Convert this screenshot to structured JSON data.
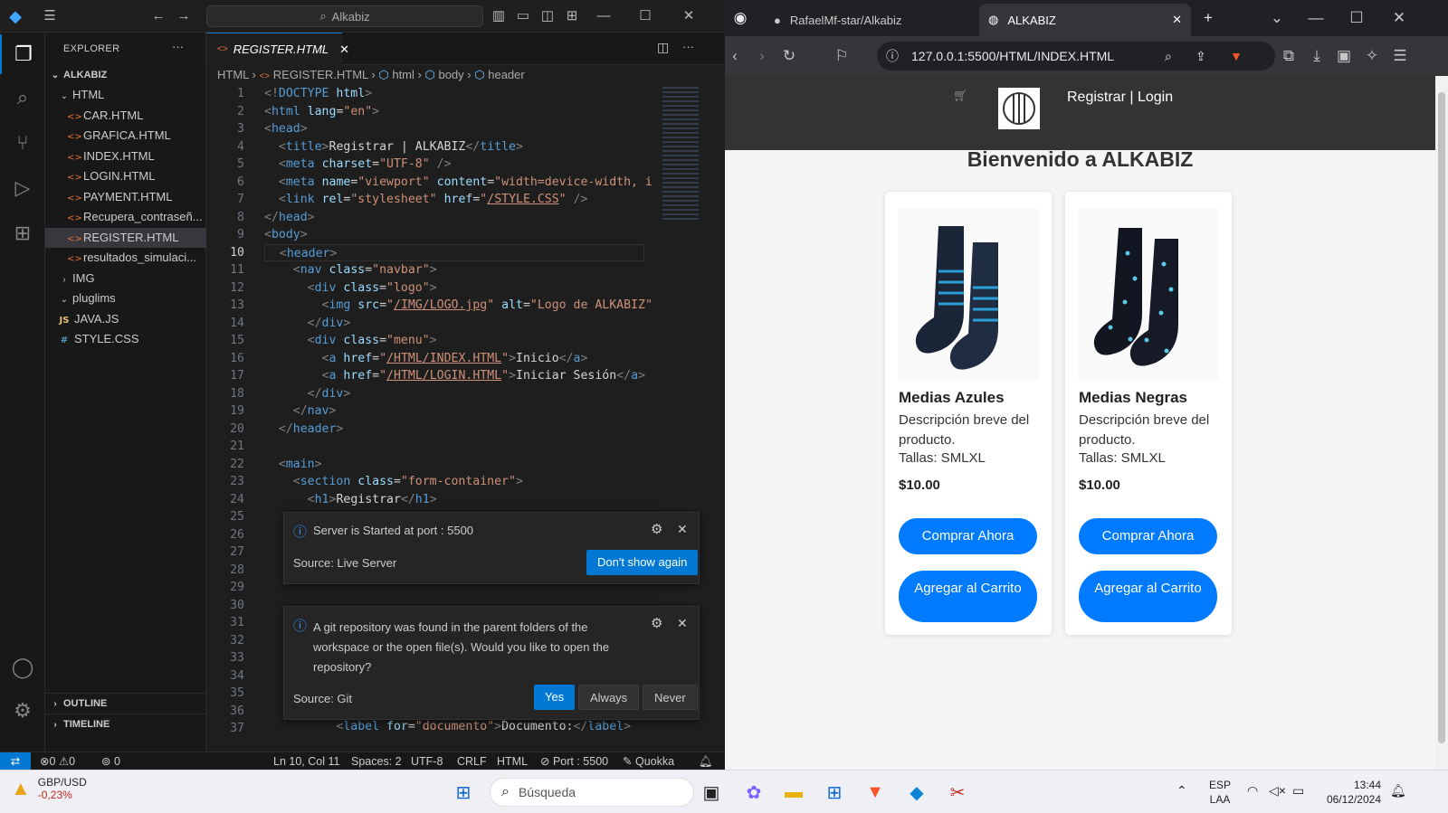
{
  "vscode": {
    "search_text": "Alkabiz",
    "explorer_title": "EXPLORER",
    "root_folder": "ALKABIZ",
    "tree": [
      {
        "label": "HTML",
        "type": "folder-open"
      },
      {
        "label": "CAR.HTML",
        "type": "html"
      },
      {
        "label": "GRAFICA.HTML",
        "type": "html"
      },
      {
        "label": "INDEX.HTML",
        "type": "html"
      },
      {
        "label": "LOGIN.HTML",
        "type": "html"
      },
      {
        "label": "PAYMENT.HTML",
        "type": "html"
      },
      {
        "label": "Recupera_contraseñ...",
        "type": "html"
      },
      {
        "label": "REGISTER.HTML",
        "type": "html",
        "selected": true
      },
      {
        "label": "resultados_simulaci...",
        "type": "html"
      },
      {
        "label": "IMG",
        "type": "folder"
      },
      {
        "label": "pluglims",
        "type": "folder-open"
      },
      {
        "label": "JAVA.JS",
        "type": "js"
      },
      {
        "label": "STYLE.CSS",
        "type": "css"
      }
    ],
    "outline_label": "OUTLINE",
    "timeline_label": "TIMELINE",
    "active_tab": "REGISTER.HTML",
    "breadcrumbs": [
      "HTML",
      "REGISTER.HTML",
      "html",
      "body",
      "header"
    ],
    "line_numbers": [
      "1",
      "2",
      "3",
      "4",
      "5",
      "6",
      "7",
      "8",
      "9",
      "10",
      "11",
      "12",
      "13",
      "14",
      "15",
      "16",
      "17",
      "18",
      "19",
      "20",
      "21",
      "22",
      "23",
      "24",
      "25",
      "26",
      "27",
      "28",
      "29",
      "30",
      "31",
      "32",
      "33",
      "34",
      "35",
      "36",
      "37"
    ],
    "current_line": "10",
    "notifications": [
      {
        "message": "Server is Started at port : 5500",
        "source": "Source: Live Server",
        "buttons": [
          "Don't show again"
        ]
      },
      {
        "message": "A git repository was found in the parent folders of the workspace or the open file(s). Would you like to open the repository?",
        "source": "Source: Git",
        "buttons": [
          "Yes",
          "Always",
          "Never"
        ]
      }
    ],
    "status": {
      "errors": "0",
      "warnings": "0",
      "ports": "0",
      "cursor": "Ln 10, Col 11",
      "spaces": "Spaces: 2",
      "encoding": "UTF-8",
      "eol": "CRLF",
      "language": "HTML",
      "port": "Port : 5500",
      "quokka": "Quokka"
    }
  },
  "browser": {
    "tab1_title": "RafaelMf-star/Alkabiz",
    "tab2_title": "ALKABIZ",
    "url": "127.0.0.1:5500/HTML/INDEX.HTML",
    "site": {
      "nav_links": "Registrar | Login",
      "heading": "Bienvenido a ALKABIZ",
      "products": [
        {
          "name": "Medias Azules",
          "description": "Descripción breve del producto.",
          "sizes": "Tallas: SMLXL",
          "price": "$10.00",
          "buy_label": "Comprar Ahora",
          "cart_label": "Agregar al Carrito",
          "stripe_color": "#2a9fd6"
        },
        {
          "name": "Medias Negras",
          "description": "Descripción breve del producto.",
          "sizes": "Tallas: SMLXL",
          "price": "$10.00",
          "buy_label": "Comprar Ahora",
          "cart_label": "Agregar al Carrito",
          "stripe_color": "#5bc8e8"
        }
      ]
    }
  },
  "taskbar": {
    "ticker_name": "GBP/USD",
    "ticker_change": "-0,23%",
    "search_placeholder": "Búsqueda",
    "lang_top": "ESP",
    "lang_bottom": "LAA",
    "time": "13:44",
    "date": "06/12/2024"
  },
  "colors": {
    "vscode_accent": "#0078d4",
    "site_button": "#007bff",
    "site_header": "#333333",
    "ticker_negative": "#c42b1c"
  }
}
